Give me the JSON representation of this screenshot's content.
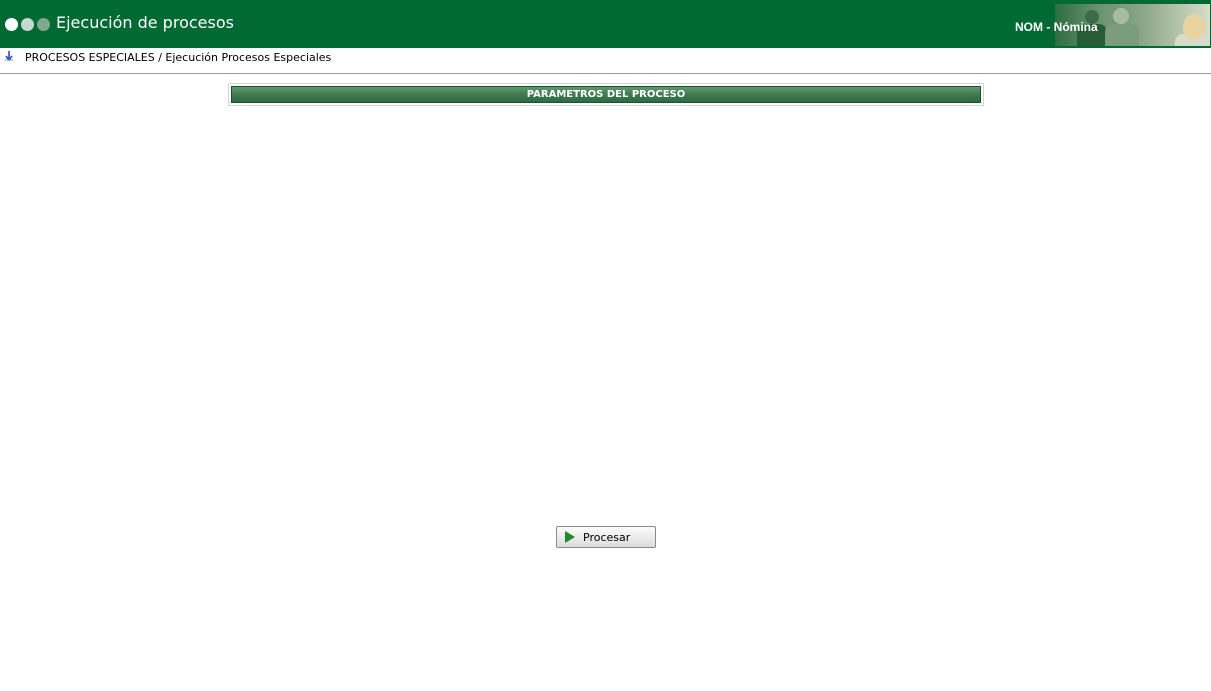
{
  "header": {
    "title": "Ejecución de procesos",
    "module": "NOM - Nómina",
    "bg_color": "#006a32"
  },
  "breadcrumb": {
    "text": "PROCESOS ESPECIALES / Ejecución Procesos Especiales",
    "icon": "arrow-down-icon"
  },
  "section": {
    "title": "PARAMETROS DEL PROCESO",
    "bar_color": "#3f7a50"
  },
  "actions": {
    "process_label": "Procesar",
    "process_icon": "play-icon",
    "icon_color": "#1e8a2e"
  }
}
